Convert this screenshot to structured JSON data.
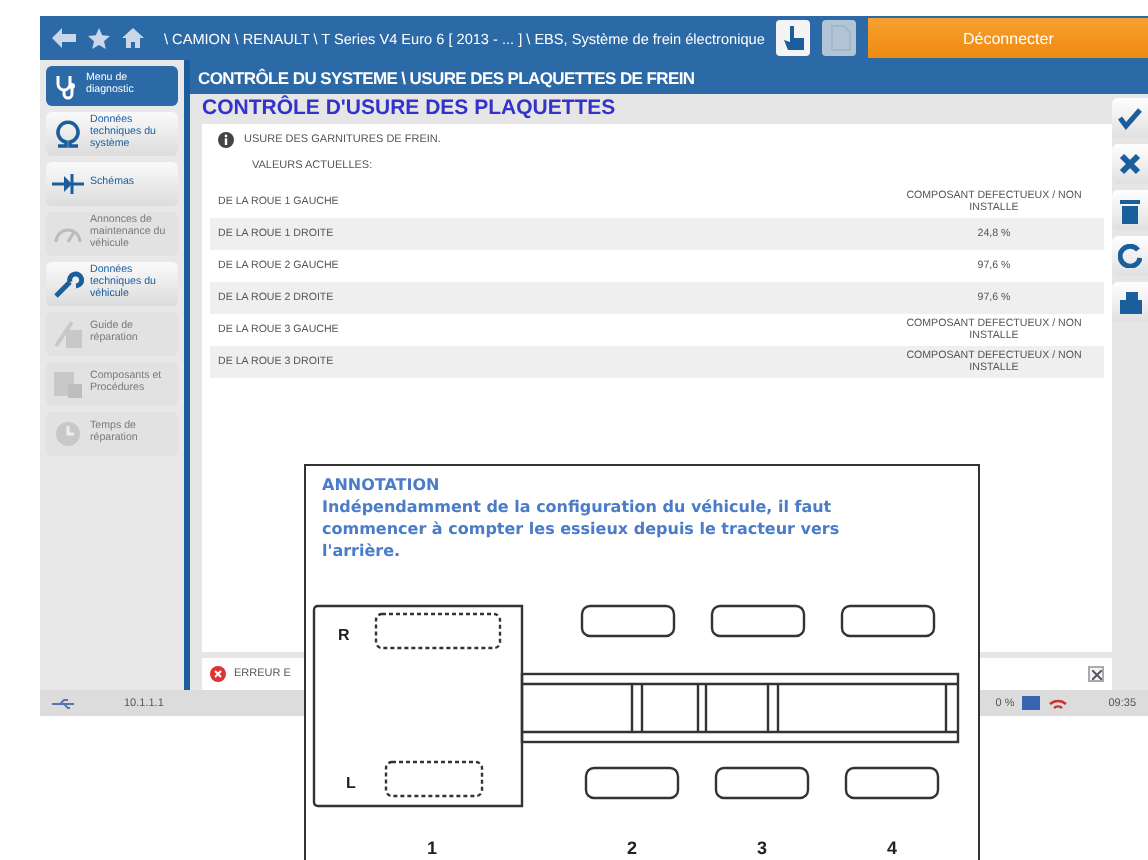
{
  "top_bar": {
    "breadcrumb": "\\ CAMION \\ RENAULT \\ T Series V4 Euro 6 [ 2013 - ... ] \\ EBS, Système de frein électronique",
    "logout_button": "Déconnecter",
    "tools": [
      {
        "kind": "hand",
        "disabled": false
      },
      {
        "kind": "document",
        "disabled": true
      }
    ]
  },
  "sidebar": {
    "items": [
      {
        "label": "Menu de diagnostic",
        "kind": "menu",
        "disabled": false
      },
      {
        "label": "Données techniques du système",
        "kind": "omega",
        "disabled": false
      },
      {
        "label": "Schémas",
        "kind": "schema",
        "disabled": false
      },
      {
        "label": "Annonces de maintenance du véhicule",
        "kind": "maintenance",
        "disabled": true
      },
      {
        "label": "Données techniques du véhicule",
        "kind": "wrench",
        "disabled": false
      },
      {
        "label": "Guide de réparation",
        "kind": "guide",
        "disabled": true
      },
      {
        "label": "Composants et Procédures",
        "kind": "components",
        "disabled": true
      },
      {
        "label": "Temps de réparation",
        "kind": "time",
        "disabled": true
      }
    ]
  },
  "header": "CONTRÔLE DU SYSTEME \\ USURE DES PLAQUETTES DE FREIN",
  "title": "CONTRÔLE D'USURE DES PLAQUETTES",
  "info": "USURE DES GARNITURES DE FREIN.",
  "subheading": "VALEURS ACTUELLES:",
  "rows": [
    {
      "label": "DE LA ROUE 1 GAUCHE",
      "value": "COMPOSANT DEFECTUEUX / NON INSTALLE"
    },
    {
      "label": "DE LA ROUE 1 DROITE",
      "value": "24,8 %"
    },
    {
      "label": "DE LA ROUE 2 GAUCHE",
      "value": "97,6 %"
    },
    {
      "label": "DE LA ROUE 2 DROITE",
      "value": "97,6 %"
    },
    {
      "label": "DE LA ROUE 3 GAUCHE",
      "value": "COMPOSANT DEFECTUEUX / NON INSTALLE"
    },
    {
      "label": "DE LA ROUE 3 DROITE",
      "value": "COMPOSANT DEFECTUEUX / NON INSTALLE"
    }
  ],
  "toolbar": [
    {
      "kind": "check"
    },
    {
      "kind": "cross"
    },
    {
      "kind": "trash"
    },
    {
      "kind": "refresh"
    },
    {
      "kind": "print"
    }
  ],
  "error_bar": {
    "text": "ERREUR E"
  },
  "status_bar": {
    "address": "10.1.1.1",
    "percent": "0 %",
    "time": "09:35"
  },
  "annotation": {
    "title": "ANNOTATION",
    "text": "Indépendamment de la configuration du véhicule, il faut commencer à compter les essieux depuis le tracteur vers l'arrière.",
    "side_labels": [
      "R",
      "L"
    ],
    "axle_labels": [
      "1",
      "2",
      "3",
      "4"
    ]
  }
}
